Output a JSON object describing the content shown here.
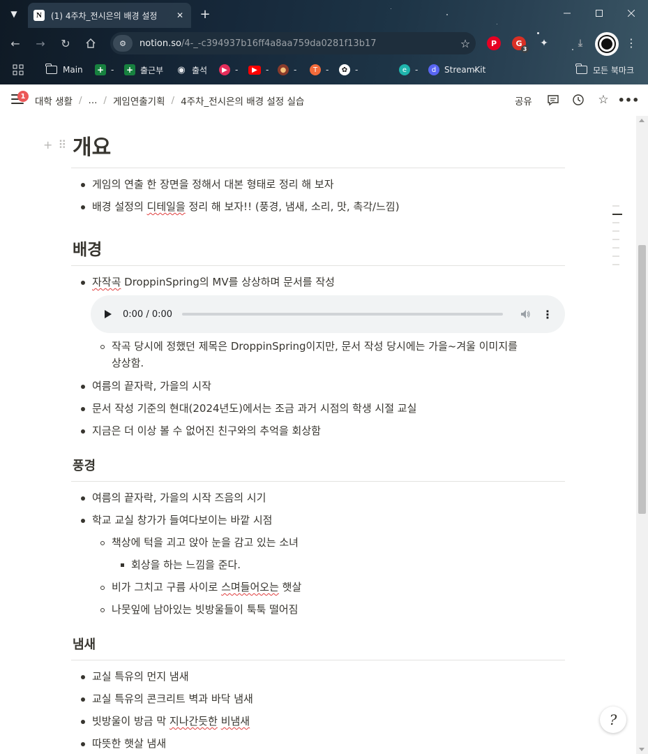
{
  "browser": {
    "tab_title": "(1) 4주차_전시은의 배경 설정",
    "tab_close": "✕",
    "new_tab": "+",
    "url_host": "notion.so",
    "url_path": "/4-_-c394937b16ff4a8aa759da0281f13b17",
    "extension_badge": "3",
    "bookmarks": [
      {
        "label": "Main",
        "icon": "folder-icon"
      },
      {
        "label": "-",
        "icon": "sheets-icon"
      },
      {
        "label": "출근부",
        "icon": "sheets-icon"
      },
      {
        "label": "출석",
        "icon": "globe-icon"
      },
      {
        "label": "-",
        "icon": "media-icon"
      },
      {
        "label": "-",
        "icon": "youtube-icon"
      },
      {
        "label": "-",
        "icon": "avatar-icon"
      },
      {
        "label": "-",
        "icon": "app-icon"
      },
      {
        "label": "-",
        "icon": "openai-icon"
      },
      {
        "label": "-",
        "icon": "edge-icon"
      },
      {
        "label": "StreamKit",
        "icon": "discord-icon"
      }
    ],
    "all_bookmarks": "모든 북마크"
  },
  "topbar": {
    "notification_count": "1",
    "breadcrumbs": [
      "대학 생활",
      "...",
      "게임연출기획",
      "4주차_전시은의 배경 설정 실습"
    ],
    "separator": "/",
    "share_label": "공유"
  },
  "page": {
    "h1_overview": "개요",
    "overview_items": [
      "게임의 연출 한 장면을 정해서 대본 형태로 정리 해 보자",
      {
        "pre": "배경 설정의 ",
        "squig": "디테일을",
        "post": " 정리 해 보자!! (풍경, 냄새, 소리, 맛, 촉각/느낌)"
      }
    ],
    "h2_background": "배경",
    "background_item1": {
      "squig": "자작곡",
      "post": " DroppinSpring의 MV를 상상하며 문서를 작성"
    },
    "audio_time": "0:00 / 0:00",
    "background_sub": [
      "작곡 당시에 정했던 제목은 DroppinSpring이지만, 문서 작성 당시에는 가을~겨울 이미지를",
      "상상함."
    ],
    "background_items": [
      "여름의 끝자락, 가을의 시작",
      "문서 작성 기준의 현대(2024년도)에서는 조금 과거 시점의 학생 시절 교실",
      "지금은 더 이상 볼 수 없어진 친구와의 추억을 회상함"
    ],
    "h3_scenery": "풍경",
    "scenery_items": [
      "여름의 끝자락, 가을의 시작 즈음의 시기",
      "학교 교실 창가가 들여다보이는 바깥 시점"
    ],
    "scenery_sub1": "책상에 턱을 괴고 앉아 눈을 감고 있는 소녀",
    "scenery_subsub": "회상을 하는 느낌을 준다.",
    "scenery_sub2": {
      "pre": "비가 그치고 구름 사이로 ",
      "squig": "스며들어오는",
      "post": " 햇살"
    },
    "scenery_sub3": "나뭇잎에 남아있는 빗방울들이 툭툭 떨어짐",
    "h3_smell": "냄새",
    "smell_items": [
      "교실 특유의 먼지 냄새",
      "교실 특유의 콘크리트 벽과 바닥 냄새"
    ],
    "smell_item3": {
      "pre": "빗방울이 방금 막 ",
      "squig1": "지나간듯한",
      "mid": " ",
      "squig2": "비냄새",
      "post": ""
    },
    "smell_item4": "따뜻한 햇살 냄새"
  },
  "help_icon": "?"
}
